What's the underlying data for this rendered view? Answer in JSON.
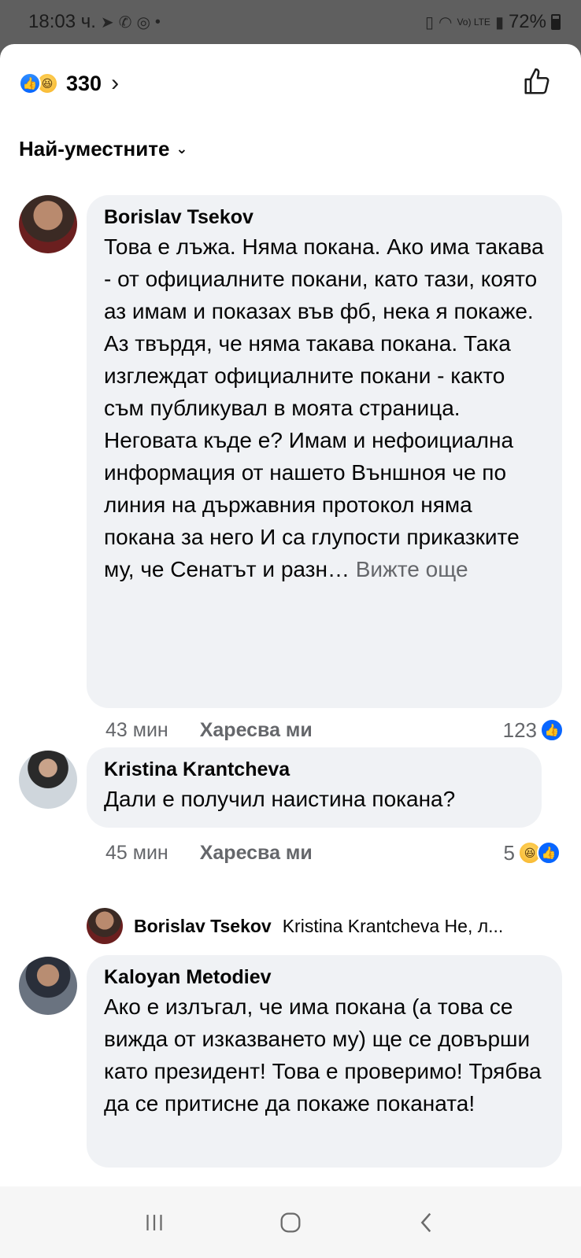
{
  "status_bar": {
    "time": "18:03 ч.",
    "battery": "72%",
    "network": "Vo) LTE"
  },
  "reactions": {
    "count": "330"
  },
  "sort": {
    "label": "Най-уместните"
  },
  "comments": [
    {
      "author": "Borislav Tsekov",
      "text": "Това е лъжа. Няма покана. Ако има такава - от официалните покани, като тази, която аз имам и показах във фб, нека я покаже. Аз твърдя, че няма такава покана. Така изглеждат официалните покани - както съм публикувал в моята страница. Неговата къде е? Имам и нефоициална информация от нашето Външноя че по линия на държавния протокол няма покана за него   И са глупости приказките му, че Сенатът и разн…",
      "see_more": "Вижте още",
      "time": "43 мин",
      "like_label": "Харесва ми",
      "reaction_count": "123"
    },
    {
      "author": "Kristina Krantcheva",
      "text": "Дали е получил наистина покана?",
      "time": "45 мин",
      "like_label": "Харесва ми",
      "reaction_count": "5"
    },
    {
      "author": "Kaloyan Metodiev",
      "text": "Ако е излъгал, че има покана (а това се вижда от изказването му) ще се довърши като президент! Това е проверимо! Трябва да се притисне да покаже поканата!"
    }
  ],
  "reply_preview": {
    "author": "Borislav Tsekov",
    "text": "Kristina Krantcheva Не, л..."
  },
  "icons": {
    "like": "like-icon",
    "haha": "haha-icon",
    "thumbs_up": "thumbs-up-icon"
  },
  "colors": {
    "accent": "#0866ff",
    "bubble": "#f0f2f5",
    "secondary_text": "#65676b"
  }
}
